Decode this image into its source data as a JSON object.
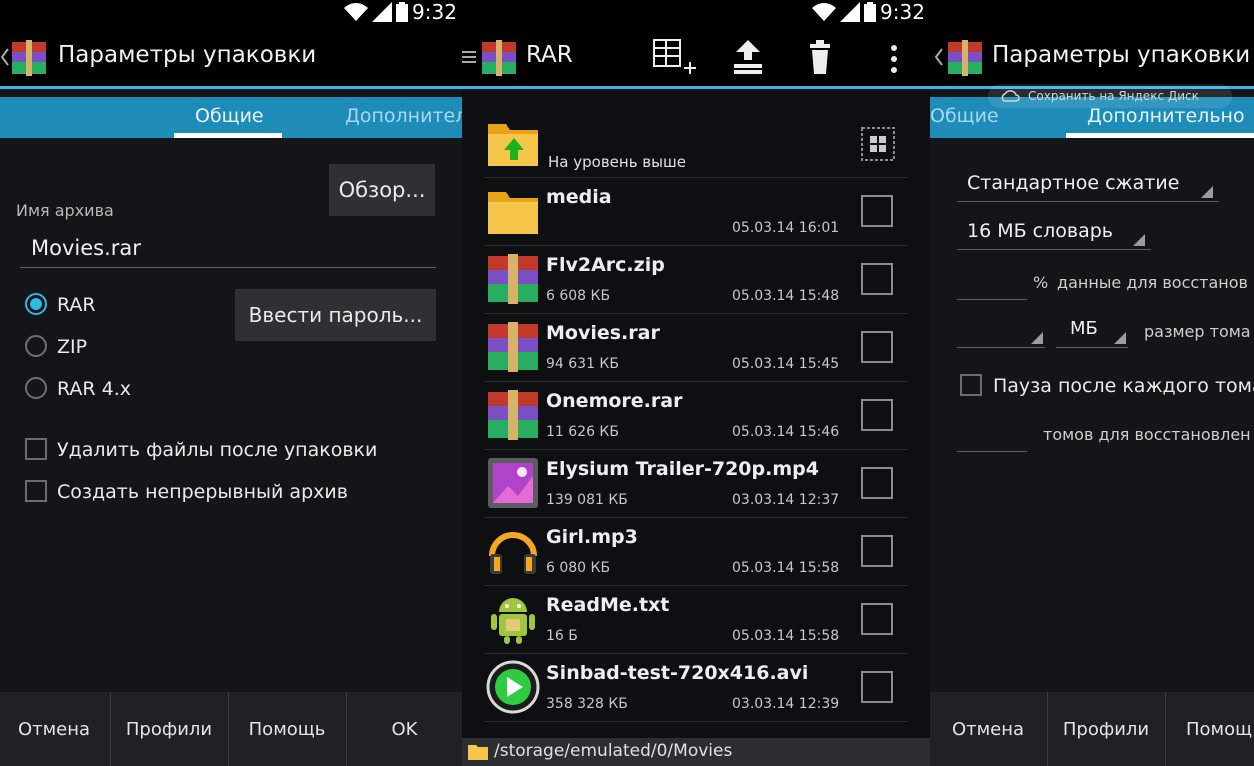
{
  "status_bar": {
    "time_1": "9:32",
    "time_2": "9:32"
  },
  "left_panel": {
    "title": "Параметры упаковки",
    "tabs": [
      {
        "label": "Общие"
      },
      {
        "label": "Дополнител"
      }
    ],
    "browse_button": "Обзор...",
    "archive_name_label": "Имя архива",
    "archive_name_value": "Movies.rar",
    "formats": [
      {
        "label": "RAR",
        "checked": true
      },
      {
        "label": "ZIP",
        "checked": false
      },
      {
        "label": "RAR 4.x",
        "checked": false
      }
    ],
    "password_button": "Ввести пароль...",
    "options": [
      {
        "label": "Удалить файлы после упаковки"
      },
      {
        "label": "Создать непрерывный архив"
      }
    ],
    "buttons": {
      "cancel": "Отмена",
      "profiles": "Профили",
      "help": "Помощь",
      "ok": "OK"
    }
  },
  "middle_panel": {
    "title": "RAR",
    "up_label": "На уровень выше",
    "files": [
      {
        "name": "media",
        "size": "",
        "date": "05.03.14 16:01",
        "icon": "folder-icon"
      },
      {
        "name": "Flv2Arc.zip",
        "size": "6 608 КБ",
        "date": "05.03.14 15:48",
        "icon": "archive-icon"
      },
      {
        "name": "Movies.rar",
        "size": "94 631 КБ",
        "date": "05.03.14 15:45",
        "icon": "archive-icon"
      },
      {
        "name": "Onemore.rar",
        "size": "11 626 КБ",
        "date": "05.03.14 15:46",
        "icon": "archive-icon"
      },
      {
        "name": "Elysium Trailer-720p.mp4",
        "size": "139 081 КБ",
        "date": "03.03.14 12:37",
        "icon": "video-icon"
      },
      {
        "name": "Girl.mp3",
        "size": "6 080 КБ",
        "date": "05.03.14 15:58",
        "icon": "headphones-icon"
      },
      {
        "name": "ReadMe.txt",
        "size": "16 Б",
        "date": "05.03.14 15:58",
        "icon": "android-icon"
      },
      {
        "name": "Sinbad-test-720x416.avi",
        "size": "358 328 КБ",
        "date": "03.03.14 12:39",
        "icon": "play-icon"
      }
    ],
    "path": "/storage/emulated/0/Movies"
  },
  "right_panel": {
    "title": "Параметры упаковки",
    "toast": "Сохранить на Яндекс Диск",
    "tabs": [
      {
        "label": "Общие"
      },
      {
        "label": "Дополнительно"
      }
    ],
    "compression": "Стандартное сжатие",
    "dictionary": "16 МБ словарь",
    "recovery_percent_unit": "%",
    "recovery_label": "данные для восстанов",
    "volume_unit": "МБ",
    "volume_label": "размер тома",
    "pause_label": "Пауза после каждого тома",
    "recovery_volumes_label": "томов для восстановлен",
    "buttons": {
      "cancel": "Отмена",
      "profiles": "Профили",
      "help": "Помощ"
    }
  }
}
